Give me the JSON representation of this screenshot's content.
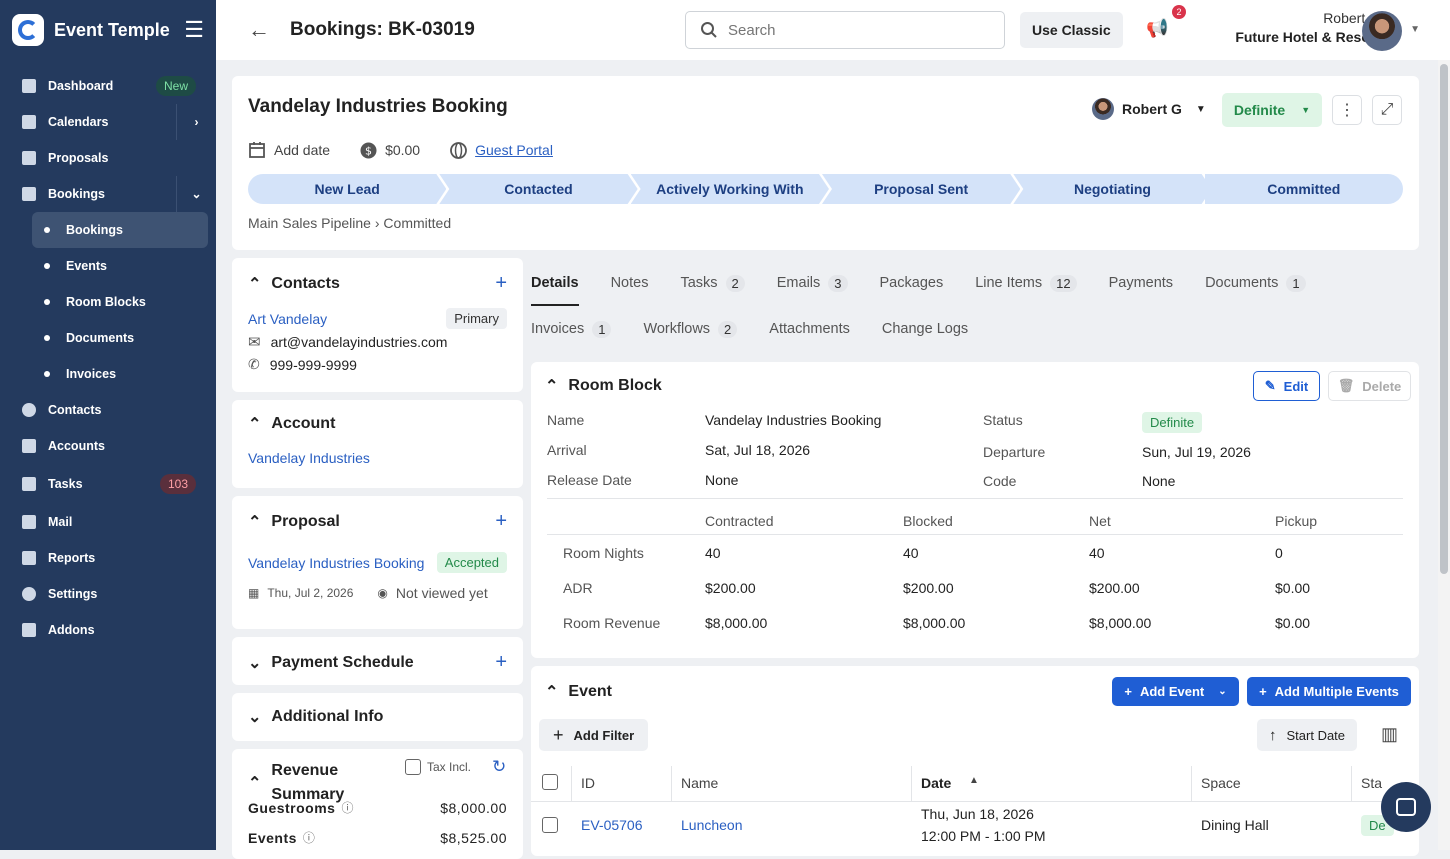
{
  "app": {
    "name": "Event Temple"
  },
  "nav": {
    "dashboard": "Dashboard",
    "dashboard_badge": "New",
    "calendars": "Calendars",
    "proposals": "Proposals",
    "bookings": "Bookings",
    "sub_bookings": "Bookings",
    "sub_events": "Events",
    "sub_room_blocks": "Room Blocks",
    "sub_documents": "Documents",
    "sub_invoices": "Invoices",
    "contacts": "Contacts",
    "accounts": "Accounts",
    "tasks": "Tasks",
    "tasks_badge": "103",
    "mail": "Mail",
    "reports": "Reports",
    "settings": "Settings",
    "addons": "Addons"
  },
  "topbar": {
    "title": "Bookings: BK-03019",
    "search_placeholder": "Search",
    "use_classic": "Use Classic",
    "notif_count": "2",
    "user_name": "Robert G",
    "hotel": "Future Hotel & Resort"
  },
  "booking": {
    "name": "Vandelay Industries Booking",
    "owner": "Robert G",
    "status": "Definite",
    "add_date": "Add date",
    "amount": "$0.00",
    "guest_portal": "Guest Portal",
    "stages": [
      "New Lead",
      "Contacted",
      "Actively Working With",
      "Proposal Sent",
      "Negotiating",
      "Committed"
    ],
    "pipeline": "Main Sales Pipeline",
    "pipeline_stage": "Committed"
  },
  "contacts": {
    "title": "Contacts",
    "name": "Art Vandelay",
    "badge": "Primary",
    "email": "art@vandelayindustries.com",
    "phone": "999-999-9999"
  },
  "account": {
    "title": "Account",
    "name": "Vandelay Industries"
  },
  "proposal": {
    "title": "Proposal",
    "name": "Vandelay Industries Booking",
    "status": "Accepted",
    "date": "Thu, Jul 2, 2026",
    "viewed": "Not viewed yet"
  },
  "payment_schedule": {
    "title": "Payment Schedule"
  },
  "additional_info": {
    "title": "Additional Info"
  },
  "revenue": {
    "title_1": "Revenue",
    "title_2": "Summary",
    "tax_label": "Tax Incl.",
    "guestrooms_label": "Guestrooms",
    "guestrooms_value": "$8,000.00",
    "events_label": "Events",
    "events_value": "$8,525.00"
  },
  "tabs": {
    "row1": [
      {
        "label": "Details",
        "count": ""
      },
      {
        "label": "Notes",
        "count": ""
      },
      {
        "label": "Tasks",
        "count": "2"
      },
      {
        "label": "Emails",
        "count": "3"
      },
      {
        "label": "Packages",
        "count": ""
      },
      {
        "label": "Line Items",
        "count": "12"
      },
      {
        "label": "Payments",
        "count": ""
      },
      {
        "label": "Documents",
        "count": "1"
      }
    ],
    "row2": [
      {
        "label": "Invoices",
        "count": "1"
      },
      {
        "label": "Workflows",
        "count": "2"
      },
      {
        "label": "Attachments",
        "count": ""
      },
      {
        "label": "Change Logs",
        "count": ""
      }
    ]
  },
  "room_block": {
    "title": "Room Block",
    "edit": "Edit",
    "delete": "Delete",
    "name_label": "Name",
    "name_value": "Vandelay Industries Booking",
    "status_label": "Status",
    "status_value": "Definite",
    "arrival_label": "Arrival",
    "arrival_value": "Sat, Jul 18, 2026",
    "departure_label": "Departure",
    "departure_value": "Sun, Jul 19, 2026",
    "release_label": "Release Date",
    "release_value": "None",
    "code_label": "Code",
    "code_value": "None",
    "columns": [
      "Contracted",
      "Blocked",
      "Net",
      "Pickup"
    ],
    "rows": [
      {
        "label": "Room Nights",
        "values": [
          "40",
          "40",
          "40",
          "0"
        ]
      },
      {
        "label": "ADR",
        "values": [
          "$200.00",
          "$200.00",
          "$200.00",
          "$0.00"
        ]
      },
      {
        "label": "Room Revenue",
        "values": [
          "$8,000.00",
          "$8,000.00",
          "$8,000.00",
          "$0.00"
        ]
      }
    ]
  },
  "event": {
    "title": "Event",
    "add_event": "Add Event",
    "add_multiple": "Add Multiple Events",
    "add_filter": "Add Filter",
    "sort": "Start Date",
    "columns": {
      "id": "ID",
      "name": "Name",
      "date": "Date",
      "space": "Space",
      "status": "Sta"
    },
    "row": {
      "id": "EV-05706",
      "name": "Luncheon",
      "date": "Thu, Jun 18, 2026",
      "time": "12:00 PM - 1:00 PM",
      "space": "Dining Hall",
      "status": "De"
    }
  }
}
